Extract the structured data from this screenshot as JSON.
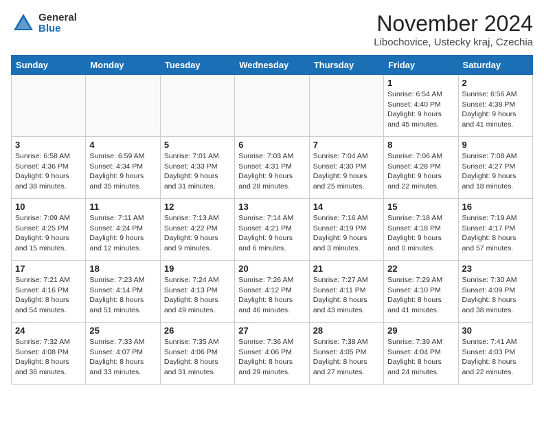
{
  "header": {
    "logo_general": "General",
    "logo_blue": "Blue",
    "month_title": "November 2024",
    "location": "Libochovice, Ustecky kraj, Czechia"
  },
  "weekdays": [
    "Sunday",
    "Monday",
    "Tuesday",
    "Wednesday",
    "Thursday",
    "Friday",
    "Saturday"
  ],
  "weeks": [
    [
      {
        "day": "",
        "info": ""
      },
      {
        "day": "",
        "info": ""
      },
      {
        "day": "",
        "info": ""
      },
      {
        "day": "",
        "info": ""
      },
      {
        "day": "",
        "info": ""
      },
      {
        "day": "1",
        "info": "Sunrise: 6:54 AM\nSunset: 4:40 PM\nDaylight: 9 hours and 45 minutes."
      },
      {
        "day": "2",
        "info": "Sunrise: 6:56 AM\nSunset: 4:38 PM\nDaylight: 9 hours and 41 minutes."
      }
    ],
    [
      {
        "day": "3",
        "info": "Sunrise: 6:58 AM\nSunset: 4:36 PM\nDaylight: 9 hours and 38 minutes."
      },
      {
        "day": "4",
        "info": "Sunrise: 6:59 AM\nSunset: 4:34 PM\nDaylight: 9 hours and 35 minutes."
      },
      {
        "day": "5",
        "info": "Sunrise: 7:01 AM\nSunset: 4:33 PM\nDaylight: 9 hours and 31 minutes."
      },
      {
        "day": "6",
        "info": "Sunrise: 7:03 AM\nSunset: 4:31 PM\nDaylight: 9 hours and 28 minutes."
      },
      {
        "day": "7",
        "info": "Sunrise: 7:04 AM\nSunset: 4:30 PM\nDaylight: 9 hours and 25 minutes."
      },
      {
        "day": "8",
        "info": "Sunrise: 7:06 AM\nSunset: 4:28 PM\nDaylight: 9 hours and 22 minutes."
      },
      {
        "day": "9",
        "info": "Sunrise: 7:08 AM\nSunset: 4:27 PM\nDaylight: 9 hours and 18 minutes."
      }
    ],
    [
      {
        "day": "10",
        "info": "Sunrise: 7:09 AM\nSunset: 4:25 PM\nDaylight: 9 hours and 15 minutes."
      },
      {
        "day": "11",
        "info": "Sunrise: 7:11 AM\nSunset: 4:24 PM\nDaylight: 9 hours and 12 minutes."
      },
      {
        "day": "12",
        "info": "Sunrise: 7:13 AM\nSunset: 4:22 PM\nDaylight: 9 hours and 9 minutes."
      },
      {
        "day": "13",
        "info": "Sunrise: 7:14 AM\nSunset: 4:21 PM\nDaylight: 9 hours and 6 minutes."
      },
      {
        "day": "14",
        "info": "Sunrise: 7:16 AM\nSunset: 4:19 PM\nDaylight: 9 hours and 3 minutes."
      },
      {
        "day": "15",
        "info": "Sunrise: 7:18 AM\nSunset: 4:18 PM\nDaylight: 9 hours and 0 minutes."
      },
      {
        "day": "16",
        "info": "Sunrise: 7:19 AM\nSunset: 4:17 PM\nDaylight: 8 hours and 57 minutes."
      }
    ],
    [
      {
        "day": "17",
        "info": "Sunrise: 7:21 AM\nSunset: 4:16 PM\nDaylight: 8 hours and 54 minutes."
      },
      {
        "day": "18",
        "info": "Sunrise: 7:23 AM\nSunset: 4:14 PM\nDaylight: 8 hours and 51 minutes."
      },
      {
        "day": "19",
        "info": "Sunrise: 7:24 AM\nSunset: 4:13 PM\nDaylight: 8 hours and 49 minutes."
      },
      {
        "day": "20",
        "info": "Sunrise: 7:26 AM\nSunset: 4:12 PM\nDaylight: 8 hours and 46 minutes."
      },
      {
        "day": "21",
        "info": "Sunrise: 7:27 AM\nSunset: 4:11 PM\nDaylight: 8 hours and 43 minutes."
      },
      {
        "day": "22",
        "info": "Sunrise: 7:29 AM\nSunset: 4:10 PM\nDaylight: 8 hours and 41 minutes."
      },
      {
        "day": "23",
        "info": "Sunrise: 7:30 AM\nSunset: 4:09 PM\nDaylight: 8 hours and 38 minutes."
      }
    ],
    [
      {
        "day": "24",
        "info": "Sunrise: 7:32 AM\nSunset: 4:08 PM\nDaylight: 8 hours and 36 minutes."
      },
      {
        "day": "25",
        "info": "Sunrise: 7:33 AM\nSunset: 4:07 PM\nDaylight: 8 hours and 33 minutes."
      },
      {
        "day": "26",
        "info": "Sunrise: 7:35 AM\nSunset: 4:06 PM\nDaylight: 8 hours and 31 minutes."
      },
      {
        "day": "27",
        "info": "Sunrise: 7:36 AM\nSunset: 4:06 PM\nDaylight: 8 hours and 29 minutes."
      },
      {
        "day": "28",
        "info": "Sunrise: 7:38 AM\nSunset: 4:05 PM\nDaylight: 8 hours and 27 minutes."
      },
      {
        "day": "29",
        "info": "Sunrise: 7:39 AM\nSunset: 4:04 PM\nDaylight: 8 hours and 24 minutes."
      },
      {
        "day": "30",
        "info": "Sunrise: 7:41 AM\nSunset: 4:03 PM\nDaylight: 8 hours and 22 minutes."
      }
    ]
  ]
}
